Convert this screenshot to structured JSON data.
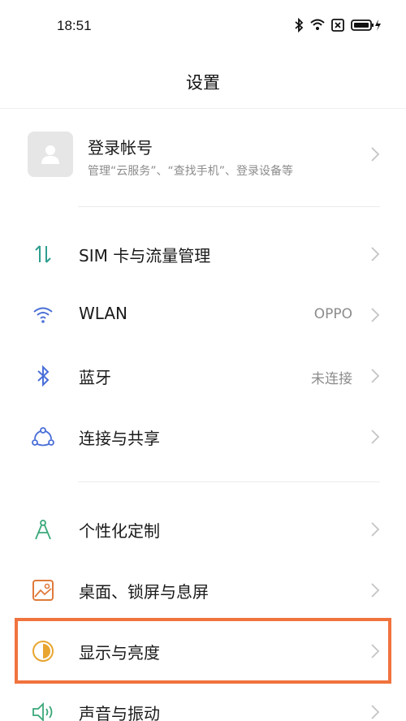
{
  "status_bar": {
    "time": "18:51",
    "icons": [
      "bluetooth-icon",
      "wifi-icon",
      "sim-off-icon",
      "battery-charging-icon"
    ]
  },
  "header": {
    "title": "设置"
  },
  "account": {
    "title": "登录帐号",
    "subtitle": "管理“云服务”、“查找手机”、登录设备等"
  },
  "settings": {
    "items": [
      {
        "label": "SIM 卡与流量管理",
        "value": "",
        "icon": "sim-data-icon",
        "color": "#2e9e8f"
      },
      {
        "label": "WLAN",
        "value": "OPPO",
        "icon": "wifi-icon",
        "color": "#4a6fd8"
      },
      {
        "label": "蓝牙",
        "value": "未连接",
        "icon": "bluetooth-icon",
        "color": "#4a6fd8"
      },
      {
        "label": "连接与共享",
        "value": "",
        "icon": "share-network-icon",
        "color": "#4a6fd8"
      },
      {
        "label": "个性化定制",
        "value": "",
        "icon": "compass-icon",
        "color": "#3aa879"
      },
      {
        "label": "桌面、锁屏与息屏",
        "value": "",
        "icon": "wallpaper-icon",
        "color": "#e07a3c"
      },
      {
        "label": "显示与亮度",
        "value": "",
        "icon": "brightness-icon",
        "color": "#e8a530"
      },
      {
        "label": "声音与振动",
        "value": "",
        "icon": "speaker-icon",
        "color": "#3aa879"
      }
    ]
  },
  "highlight": {
    "target": "显示与亮度",
    "color": "#f0733e"
  }
}
